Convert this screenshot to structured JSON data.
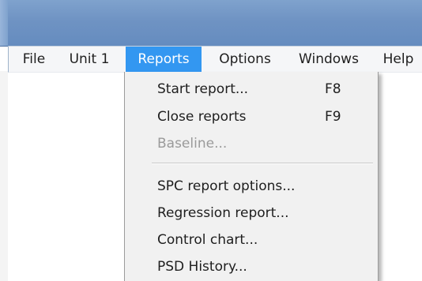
{
  "menubar": {
    "items": [
      {
        "label": "File"
      },
      {
        "label": "Unit 1"
      },
      {
        "label": "Reports"
      },
      {
        "label": "Options"
      },
      {
        "label": "Windows"
      },
      {
        "label": "Help"
      }
    ],
    "active": "Reports"
  },
  "reports_menu": {
    "items": [
      {
        "label": "Start report...",
        "shortcut": "F8",
        "enabled": true
      },
      {
        "label": "Close reports",
        "shortcut": "F9",
        "enabled": true
      },
      {
        "label": "Baseline...",
        "enabled": false
      },
      {
        "label": "SPC report options...",
        "enabled": true
      },
      {
        "label": "Regression report...",
        "enabled": true
      },
      {
        "label": "Control chart...",
        "enabled": true
      },
      {
        "label": "PSD History...",
        "enabled": true
      }
    ]
  },
  "colors": {
    "title_bar": "#6f93c3",
    "menu_highlight": "#3397f1",
    "menu_background": "#f1f1f1",
    "disabled_text": "#9a9a9a"
  }
}
